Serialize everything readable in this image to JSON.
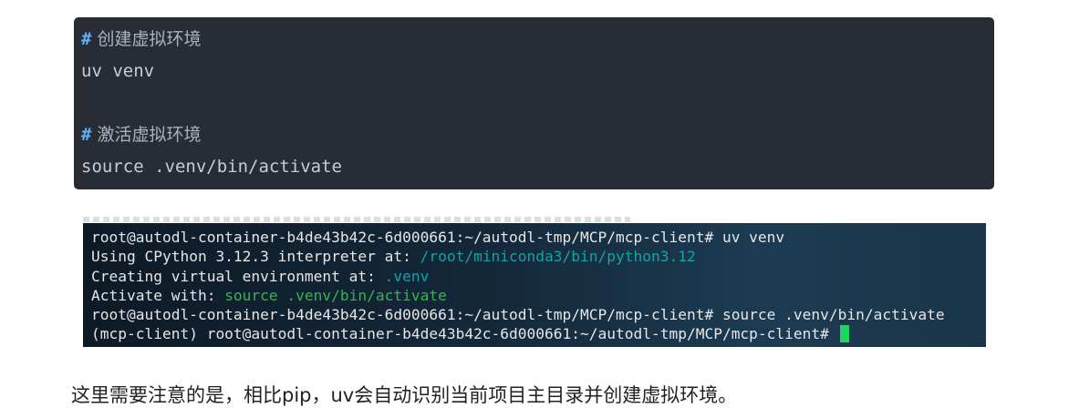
{
  "code_block": {
    "lines": [
      {
        "prefix": "#",
        "comment": " 创建虚拟环境"
      },
      {
        "code": "uv venv"
      },
      {
        "code": ""
      },
      {
        "prefix": "#",
        "comment": " 激活虚拟环境"
      },
      {
        "code": "source .venv/bin/activate"
      }
    ]
  },
  "terminal": {
    "line1": "root@autodl-container-b4de43b42c-6d000661:~/autodl-tmp/MCP/mcp-client# uv venv",
    "line2_prefix": "Using CPython 3.12.3 interpreter at: ",
    "line2_path": "/root/miniconda3/bin/python3.12",
    "line3_prefix": "Creating virtual environment at: ",
    "line3_path": ".venv",
    "line4_prefix": "Activate with: ",
    "line4_cmd": "source .venv/bin/activate",
    "line5": "root@autodl-container-b4de43b42c-6d000661:~/autodl-tmp/MCP/mcp-client# source .venv/bin/activate",
    "line6": "(mcp-client) root@autodl-container-b4de43b42c-6d000661:~/autodl-tmp/MCP/mcp-client# ",
    "colors": {
      "path_teal": "#14a3a3",
      "cmd_green": "#36b54a",
      "cursor": "#1ed760"
    }
  },
  "paragraph": {
    "text": "这里需要注意的是，相比pip，uv会自动识别当前项目主目录并创建虚拟环境。"
  }
}
